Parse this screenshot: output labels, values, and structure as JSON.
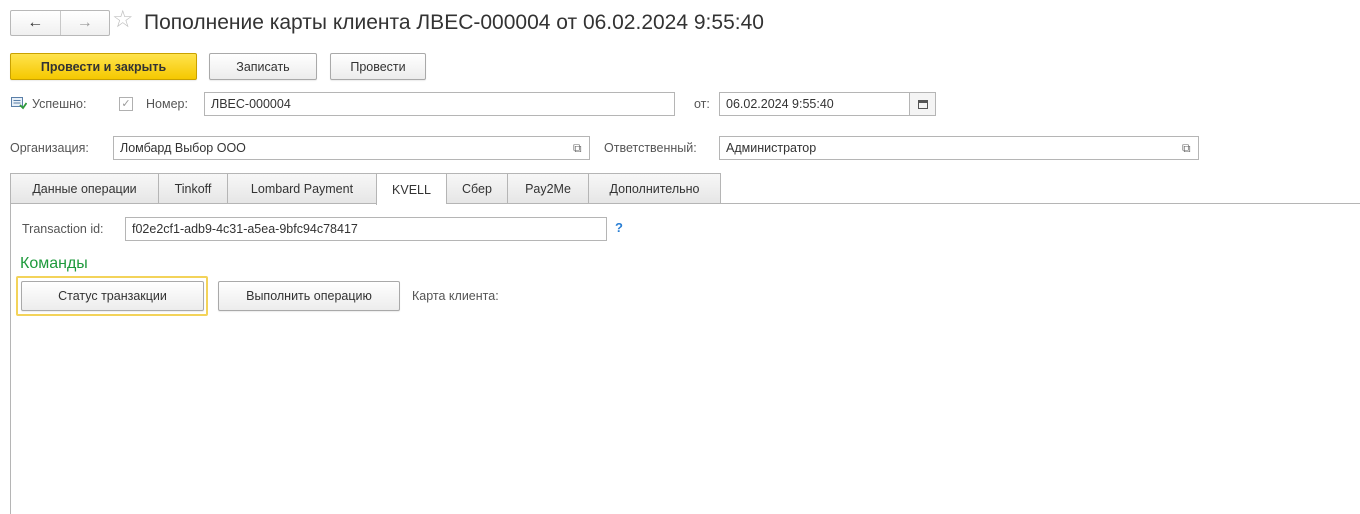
{
  "header": {
    "title": "Пополнение карты клиента ЛВЕС-000004 от 06.02.2024 9:55:40",
    "back_icon": "←",
    "forward_icon": "→",
    "star_icon": "☆"
  },
  "toolbar": {
    "post_and_close": "Провести и закрыть",
    "save": "Записать",
    "post": "Провести"
  },
  "status": {
    "success_label": "Успешно:",
    "checkbox_mark": "✓",
    "number_label": "Номер:",
    "number_value": "ЛВЕС-000004",
    "date_label": "от:",
    "date_value": "06.02.2024  9:55:40"
  },
  "org": {
    "label": "Организация:",
    "value": "Ломбард Выбор ООО",
    "responsible_label": "Ответственный:",
    "responsible_value": "Администратор",
    "open_icon": "⧉"
  },
  "tabs": [
    {
      "label": "Данные операции"
    },
    {
      "label": "Tinkoff"
    },
    {
      "label": "Lombard Payment"
    },
    {
      "label": "KVELL"
    },
    {
      "label": "Сбер"
    },
    {
      "label": "Pay2Me"
    },
    {
      "label": "Дополнительно"
    }
  ],
  "active_tab": "KVELL",
  "kvell": {
    "transaction_label": "Transaction id:",
    "transaction_value": "f02e2cf1-adb9-4c31-a5ea-9bfc94c78417",
    "help": "?",
    "commands_title": "Команды",
    "status_button": "Статус транзакции",
    "execute_button": "Выполнить операцию",
    "card_label": "Карта клиента:"
  },
  "colors": {
    "primary_button": "#f5c800",
    "section_title": "#1e9a3c",
    "help": "#2a7fd4",
    "focus": "#f3d35a"
  }
}
